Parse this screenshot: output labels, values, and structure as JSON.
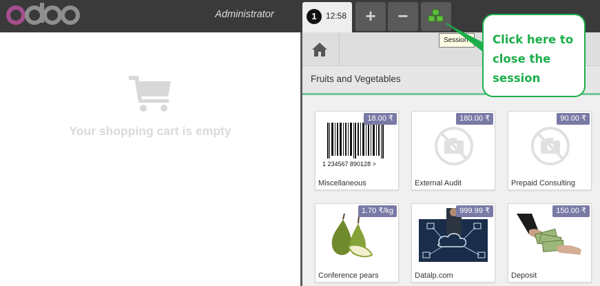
{
  "header": {
    "logo_text": "odoo",
    "user_name": "Administrator",
    "order_number": "1",
    "order_time": "12:58",
    "add_order_symbol": "+",
    "remove_order_symbol": "−",
    "close_icon": "sessions-icon",
    "tooltip": "Session"
  },
  "cart": {
    "icon": "shopping-cart-icon",
    "empty_text": "Your shopping cart is empty"
  },
  "products_pane": {
    "home_icon": "home-icon",
    "category": "Fruits and Vegetables",
    "products": [
      {
        "name": "Miscellaneous",
        "price": "18.00 ₹",
        "image": "barcode"
      },
      {
        "name": "External Audit",
        "price": "180.00 ₹",
        "image": "no-image"
      },
      {
        "name": "Prepaid Consulting",
        "price": "90.00 ₹",
        "image": "no-image"
      },
      {
        "name": "Conference pears",
        "price": "1.70 ₹/kg",
        "image": "pears"
      },
      {
        "name": "Datalp.com",
        "price": "999.99 ₹",
        "image": "cloud-diagram"
      },
      {
        "name": "Deposit",
        "price": "150.00 ₹",
        "image": "money-hands"
      }
    ],
    "barcode_number": "1 234567 890128 >"
  },
  "annotation": {
    "lines": [
      "Click here to",
      "close the",
      "session"
    ],
    "color": "#1cae4a"
  }
}
